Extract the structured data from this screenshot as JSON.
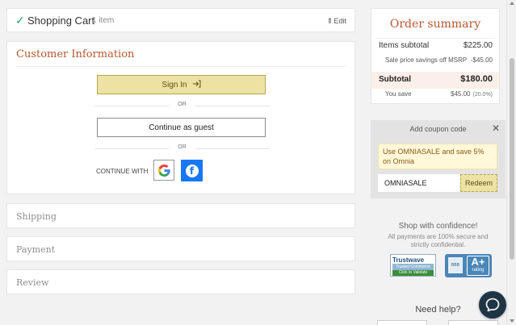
{
  "cart": {
    "title": "Shopping Cart",
    "count": "1 item",
    "edit_label": "Edit"
  },
  "customer": {
    "title": "Customer Information",
    "signin_label": "Sign In",
    "or_label": "OR",
    "guest_label": "Continue as guest",
    "continue_with_label": "CONTINUE WITH",
    "social": [
      "google-icon",
      "facebook-icon"
    ]
  },
  "steps": {
    "shipping": "Shipping",
    "payment": "Payment",
    "review": "Review"
  },
  "summary": {
    "title": "Order summary",
    "items_subtotal_label": "Items subtotal",
    "items_subtotal_value": "$225.00",
    "sale_label": "Sale price savings off MSRP",
    "sale_value": "-$45.00",
    "subtotal_label": "Subtotal",
    "subtotal_value": "$180.00",
    "save_label": "You save",
    "save_value": "$45.00",
    "save_pct": "(20.0%)"
  },
  "coupon": {
    "title": "Add coupon code",
    "promo": "Use OMNIASALE and save 5% on Omnia",
    "input_value": "OMNIASALE",
    "redeem_label": "Redeem"
  },
  "confidence": {
    "title": "Shop with confidence!",
    "text": "All payments are 100% secure and strictly confidential.",
    "trustwave_name": "Trustwave",
    "trustwave_sub": "Trusted Commerce",
    "trustwave_cta": "Click to Validate",
    "bbb_abbr": "BBB",
    "bbb_grade": "A+",
    "bbb_rating": "rating"
  },
  "help": {
    "title": "Need help?"
  },
  "colors": {
    "accent": "#b5562f",
    "button_primary": "#ede2a4",
    "facebook": "#1877f2",
    "chat": "#1e3546"
  }
}
